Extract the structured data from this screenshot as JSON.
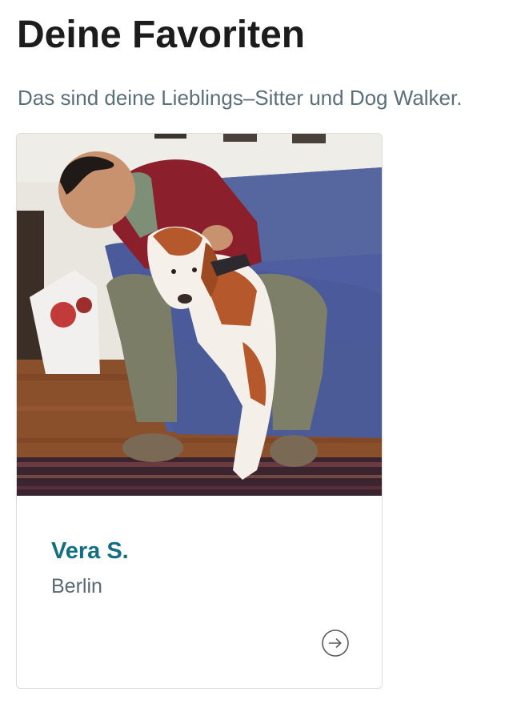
{
  "header": {
    "title": "Deine Favoriten",
    "subtitle": "Das sind deine Lieblings–Sitter und Dog Walker."
  },
  "favorites": [
    {
      "name": "Vera S.",
      "city": "Berlin",
      "photo_alt": "Vera S.",
      "action_icon": "arrow-right-circle-icon"
    }
  ],
  "colors": {
    "title": "#1c1c1c",
    "subtitle": "#5b6f7a",
    "name_accent": "#126f82",
    "city": "#5a6a72",
    "card_border": "#dcdcdc",
    "icon": "#5a5a5a"
  }
}
